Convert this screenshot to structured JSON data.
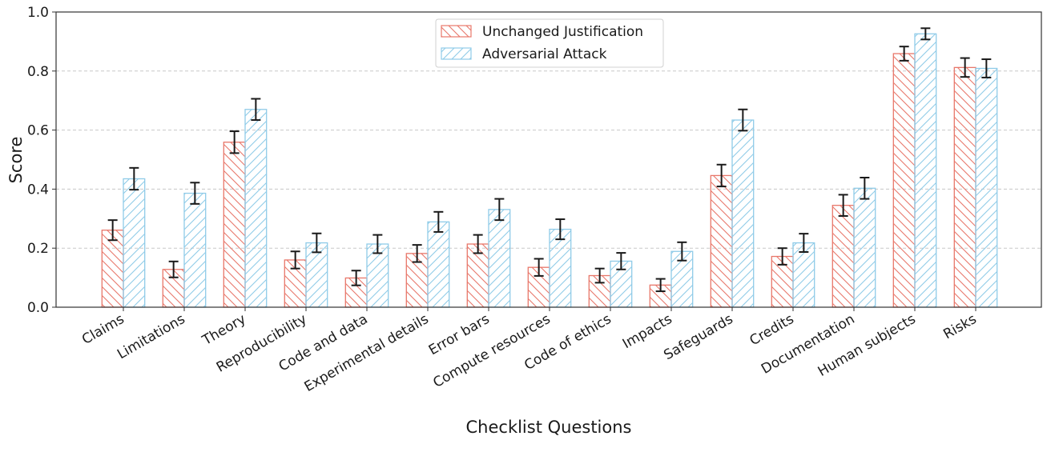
{
  "chart_data": {
    "type": "bar",
    "title": "",
    "xlabel": "Checklist Questions",
    "ylabel": "Score",
    "ylim": [
      0,
      1.0
    ],
    "yticks": [
      "0.0",
      "0.2",
      "0.4",
      "0.6",
      "0.8",
      "1.0"
    ],
    "ytick_values": [
      0,
      0.2,
      0.4,
      0.6,
      0.8,
      1.0
    ],
    "grid": "horizontal dashed",
    "legend_position": "top-center",
    "categories": [
      "Claims",
      "Limitations",
      "Theory",
      "Reproducibility",
      "Code and data",
      "Experimental details",
      "Error bars",
      "Compute resources",
      "Code of ethics",
      "Impacts",
      "Safeguards",
      "Credits",
      "Documentation",
      "Human subjects",
      "Risks"
    ],
    "series": [
      {
        "name": "Unchanged Justification",
        "color": "#e8776a",
        "hatch": "backslash",
        "values": [
          0.261,
          0.128,
          0.559,
          0.16,
          0.099,
          0.182,
          0.214,
          0.135,
          0.107,
          0.075,
          0.446,
          0.172,
          0.345,
          0.859,
          0.812
        ],
        "errors": [
          0.034,
          0.027,
          0.037,
          0.029,
          0.025,
          0.029,
          0.031,
          0.029,
          0.024,
          0.021,
          0.037,
          0.028,
          0.036,
          0.024,
          0.032
        ]
      },
      {
        "name": "Adversarial Attack",
        "color": "#8fcbe8",
        "hatch": "slash",
        "values": [
          0.435,
          0.386,
          0.67,
          0.218,
          0.214,
          0.289,
          0.331,
          0.264,
          0.156,
          0.189,
          0.634,
          0.218,
          0.403,
          0.926,
          0.809
        ],
        "errors": [
          0.037,
          0.036,
          0.036,
          0.032,
          0.031,
          0.034,
          0.036,
          0.034,
          0.028,
          0.031,
          0.036,
          0.031,
          0.036,
          0.019,
          0.031
        ]
      }
    ]
  }
}
